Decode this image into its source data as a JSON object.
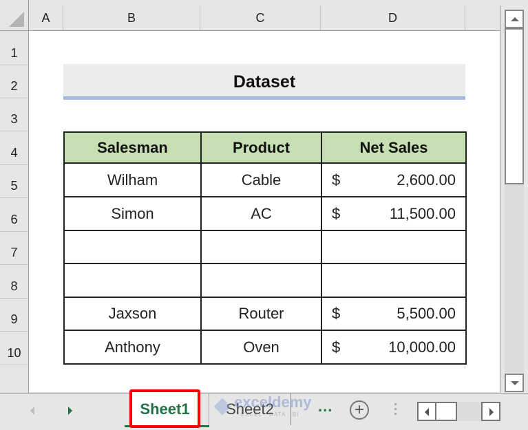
{
  "column_headers": [
    "A",
    "B",
    "C",
    "D"
  ],
  "row_headers": [
    "1",
    "2",
    "3",
    "4",
    "5",
    "6",
    "7",
    "8",
    "9",
    "10"
  ],
  "title": "Dataset",
  "table": {
    "headers": [
      "Salesman",
      "Product",
      "Net Sales"
    ],
    "rows": [
      {
        "salesman": "Wilham",
        "product": "Cable",
        "currency": "$",
        "amount": "2,600.00"
      },
      {
        "salesman": "Simon",
        "product": "AC",
        "currency": "$",
        "amount": "11,500.00"
      },
      {
        "salesman": "",
        "product": "",
        "currency": "",
        "amount": ""
      },
      {
        "salesman": "",
        "product": "",
        "currency": "",
        "amount": ""
      },
      {
        "salesman": "Jaxson",
        "product": "Router",
        "currency": "$",
        "amount": "5,500.00"
      },
      {
        "salesman": "Anthony",
        "product": "Oven",
        "currency": "$",
        "amount": "10,000.00"
      }
    ]
  },
  "sheet_tabs": [
    {
      "label": "Sheet1",
      "active": true
    },
    {
      "label": "Sheet2",
      "active": false
    }
  ],
  "more_sheets_label": "...",
  "add_sheet_label": "+",
  "watermark": {
    "text": "exceldemy",
    "subtext": "EXCEL · DATA · BI"
  },
  "colors": {
    "header_fill": "#c6e0b4",
    "title_underline": "#a5b9df",
    "active_tab_text": "#217346",
    "highlight_border": "#ff0000"
  }
}
